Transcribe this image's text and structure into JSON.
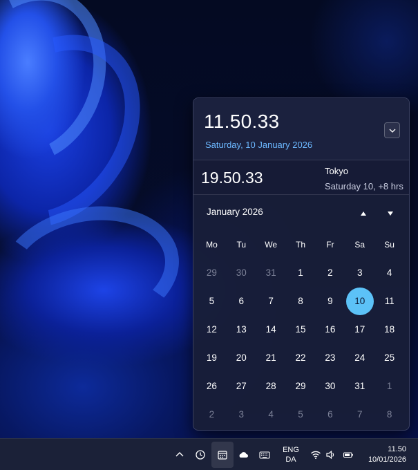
{
  "flyout": {
    "current_time": "11.50.33",
    "current_date": "Saturday, 10 January 2026",
    "world_clock": {
      "time": "19.50.33",
      "city": "Tokyo",
      "offset": "Saturday 10, +8 hrs"
    },
    "calendar": {
      "month_label": "January 2026",
      "weekdays": [
        "Mo",
        "Tu",
        "We",
        "Th",
        "Fr",
        "Sa",
        "Su"
      ],
      "days": [
        {
          "label": "29",
          "other": true
        },
        {
          "label": "30",
          "other": true
        },
        {
          "label": "31",
          "other": true
        },
        {
          "label": "1"
        },
        {
          "label": "2"
        },
        {
          "label": "3"
        },
        {
          "label": "4"
        },
        {
          "label": "5"
        },
        {
          "label": "6"
        },
        {
          "label": "7"
        },
        {
          "label": "8"
        },
        {
          "label": "9"
        },
        {
          "label": "10",
          "today": true
        },
        {
          "label": "11"
        },
        {
          "label": "12"
        },
        {
          "label": "13"
        },
        {
          "label": "14"
        },
        {
          "label": "15"
        },
        {
          "label": "16"
        },
        {
          "label": "17"
        },
        {
          "label": "18"
        },
        {
          "label": "19"
        },
        {
          "label": "20"
        },
        {
          "label": "21"
        },
        {
          "label": "22"
        },
        {
          "label": "23"
        },
        {
          "label": "24"
        },
        {
          "label": "25"
        },
        {
          "label": "26"
        },
        {
          "label": "27"
        },
        {
          "label": "28"
        },
        {
          "label": "29"
        },
        {
          "label": "30"
        },
        {
          "label": "31"
        },
        {
          "label": "1",
          "other": true
        },
        {
          "label": "2",
          "other": true
        },
        {
          "label": "3",
          "other": true
        },
        {
          "label": "4",
          "other": true
        },
        {
          "label": "5",
          "other": true
        },
        {
          "label": "6",
          "other": true
        },
        {
          "label": "7",
          "other": true
        },
        {
          "label": "8",
          "other": true
        }
      ],
      "today_color": "#5cc2f7"
    }
  },
  "taskbar": {
    "icons": [
      "chevron-up-icon",
      "clock-icon",
      "calendar-icon",
      "onedrive-cloud-icon",
      "keyboard-icon",
      "wifi-icon",
      "volume-icon",
      "battery-icon"
    ],
    "language_line1": "ENG",
    "language_line2": "DA",
    "tray_time": "11.50",
    "tray_date": "10/01/2026"
  },
  "colors": {
    "accent": "#6cb8ff",
    "flyout_bg": "#181e38",
    "taskbar_bg": "#1b2138"
  }
}
